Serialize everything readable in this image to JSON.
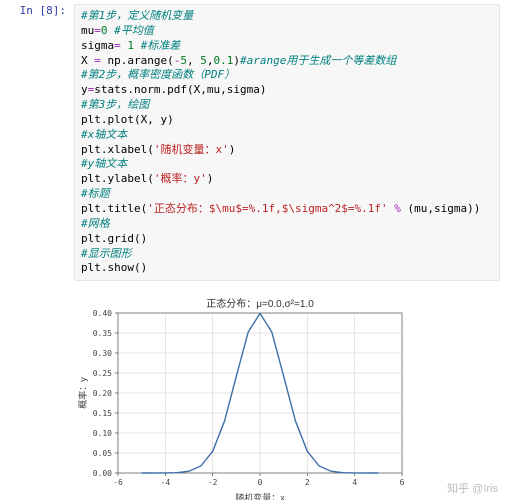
{
  "prompt": "In [8]:",
  "code": {
    "l1_cm": "#第1步，定义随机变量",
    "l2a": "mu",
    "l2b": "=",
    "l2c": "0",
    "l2d": " #平均值",
    "l3a": "sigma",
    "l3b": "= ",
    "l3c": "1",
    "l3d": " #标准差",
    "l4a": "X ",
    "l4b": "=",
    "l4c": " np.arange(",
    "l4d": "-",
    "l4e": "5",
    "l4f": ", ",
    "l4g": "5",
    "l4h": ",",
    "l4i": "0.1",
    "l4j": ")",
    "l4k": "#arange用于生成一个等差数组",
    "l5": "#第2步，概率密度函数（PDF）",
    "l6a": "y",
    "l6b": "=",
    "l6c": "stats.norm.pdf(X,mu,sigma)",
    "l7": "#第3步，绘图",
    "l8": "plt.plot(X, y)",
    "l9": "#x轴文本",
    "l10a": "plt.xlabel(",
    "l10b": "'随机变量：x'",
    "l10c": ")",
    "l11": "#y轴文本",
    "l12a": "plt.ylabel(",
    "l12b": "'概率：y'",
    "l12c": ")",
    "l13": "#标题",
    "l14a": "plt.title(",
    "l14b": "'正态分布：$\\mu$=%.1f,$\\sigma^2$=%.1f'",
    "l14c": " % ",
    "l14d": "(mu,sigma))",
    "l15": "#网格",
    "l16": "plt.grid()",
    "l17": "#显示图形",
    "l18": "plt.show()"
  },
  "chart_data": {
    "type": "line",
    "title": "正态分布：μ=0.0,σ²=1.0",
    "xlabel": "随机变量：x",
    "ylabel": "概率：y",
    "xlim": [
      -6,
      6
    ],
    "ylim": [
      0,
      0.4
    ],
    "xticks": [
      -6,
      -4,
      -2,
      0,
      2,
      4,
      6
    ],
    "yticks": [
      0.0,
      0.05,
      0.1,
      0.15,
      0.2,
      0.25,
      0.3,
      0.35,
      0.4
    ],
    "x": [
      -5.0,
      -4.5,
      -4.0,
      -3.5,
      -3.0,
      -2.5,
      -2.0,
      -1.5,
      -1.0,
      -0.5,
      0.0,
      0.5,
      1.0,
      1.5,
      2.0,
      2.5,
      3.0,
      3.5,
      4.0,
      4.5,
      5.0
    ],
    "values": [
      1.5e-06,
      1.6e-05,
      0.000134,
      0.000873,
      0.00443,
      0.01753,
      0.05399,
      0.12952,
      0.24197,
      0.35207,
      0.39894,
      0.35207,
      0.24197,
      0.12952,
      0.05399,
      0.01753,
      0.00443,
      0.000873,
      0.000134,
      1.6e-05,
      1.5e-06
    ]
  },
  "watermark": "知乎 @Iris"
}
